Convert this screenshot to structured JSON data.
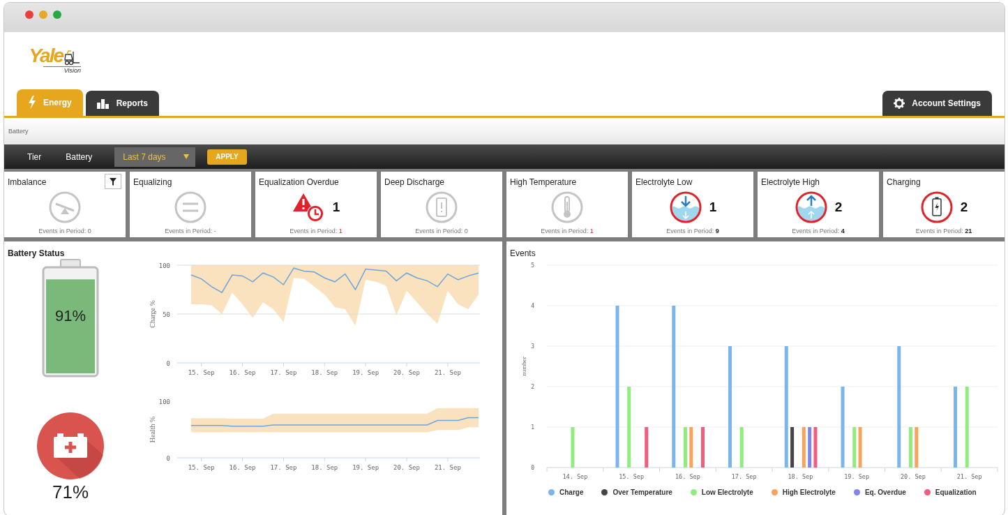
{
  "window": {
    "controls": [
      {
        "color": "#e8403a"
      },
      {
        "color": "#e6a92a"
      },
      {
        "color": "#27a844"
      }
    ]
  },
  "logo": {
    "brand": "Yale",
    "sub": "Vision"
  },
  "tabs": [
    {
      "label": "Energy",
      "kind": "bolt",
      "selected": true
    },
    {
      "label": "Reports",
      "kind": "bars",
      "selected": false
    }
  ],
  "account_button": {
    "label": "Account Settings"
  },
  "breadcrumb": "Battery",
  "filter_bar": {
    "items": [
      "Tier",
      "Battery"
    ],
    "period": {
      "value": "Last 7 days"
    },
    "apply": "APPLY"
  },
  "tiles": [
    {
      "title": "Imbalance",
      "kind": "seesaw",
      "filter_button": true,
      "events_label": "Events in Period:",
      "events_value": "0",
      "alert": false,
      "emphasized": false
    },
    {
      "title": "Equalizing",
      "kind": "equal",
      "filter_button": false,
      "events_label": "Events in Period:",
      "events_value": "-",
      "alert": false,
      "emphasized": false
    },
    {
      "title": "Equalization Overdue",
      "kind": "warning-clock",
      "count": "1",
      "filter_button": false,
      "events_label": "Events in Period:",
      "events_value": "1",
      "alert": true,
      "emphasized": false
    },
    {
      "title": "Deep Discharge",
      "kind": "battery-alert",
      "filter_button": false,
      "events_label": "Events in Period:",
      "events_value": "0",
      "alert": false,
      "emphasized": false
    },
    {
      "title": "High Temperature",
      "kind": "thermometer",
      "filter_button": false,
      "events_label": "Events in Period:",
      "events_value": "1",
      "alert": true,
      "emphasized": false
    },
    {
      "title": "Electrolyte Low",
      "kind": "water-down",
      "count": "1",
      "filter_button": false,
      "events_label": "Events in Period:",
      "events_value": "9",
      "alert": false,
      "emphasized": true
    },
    {
      "title": "Electrolyte High",
      "kind": "water-up",
      "count": "2",
      "filter_button": false,
      "events_label": "Events in Period:",
      "events_value": "4",
      "alert": false,
      "emphasized": true
    },
    {
      "title": "Charging",
      "kind": "battery-bolt",
      "count": "2",
      "filter_button": false,
      "events_label": "Events in Period:",
      "events_value": "21",
      "alert": false,
      "emphasized": true
    }
  ],
  "battery_status": {
    "title": "Battery Status",
    "charge": {
      "reading": "91%"
    },
    "health": {
      "reading": "71%"
    },
    "charge_chart": {
      "chart_data": {
        "type": "line",
        "grid": true,
        "ylabel": "Charge %",
        "ylim": [
          0,
          100
        ],
        "yticks": [
          0,
          50,
          100
        ],
        "categories": [
          null,
          "15. Sep",
          null,
          null,
          null,
          "16. Sep",
          null,
          null,
          null,
          "17. Sep",
          null,
          null,
          null,
          "18. Sep",
          null,
          null,
          null,
          "19. Sep",
          null,
          null,
          null,
          "20. Sep",
          null,
          null,
          null,
          "21. Sep",
          null,
          null,
          null
        ],
        "series": [
          {
            "type": "line",
            "color": "#6ea4dc",
            "values": [
              90,
              86,
              78,
              72,
              90,
              89,
              83,
              92,
              88,
              80,
              97,
              94,
              93,
              87,
              83,
              91,
              75,
              96,
              95,
              94,
              84,
              92,
              87,
              84,
              78,
              91,
              85,
              89,
              92
            ]
          },
          {
            "type": "area",
            "color": "#fbe2bf",
            "values": [
              100,
              100,
              100,
              100,
              100,
              100,
              100,
              100,
              100,
              100,
              100,
              100,
              100,
              100,
              100,
              100,
              100,
              100,
              100,
              100,
              100,
              100,
              100,
              100,
              100,
              100,
              100,
              100,
              100
            ]
          },
          {
            "type": "area",
            "color": "#ffffff",
            "values": [
              60,
              60,
              59,
              50,
              72,
              60,
              46,
              62,
              55,
              42,
              87,
              86,
              78,
              70,
              57,
              55,
              38,
              85,
              83,
              79,
              49,
              74,
              62,
              50,
              40,
              74,
              60,
              55,
              70
            ]
          }
        ]
      }
    },
    "health_chart": {
      "chart_data": {
        "type": "line",
        "ylabel": "Health %",
        "ylim": [
          0,
          100
        ],
        "yticks": [
          0,
          100
        ],
        "categories": [
          null,
          "15. Sep",
          null,
          null,
          null,
          "16. Sep",
          null,
          null,
          null,
          "17. Sep",
          null,
          null,
          null,
          "18. Sep",
          null,
          null,
          null,
          "19. Sep",
          null,
          null,
          null,
          "20. Sep",
          null,
          null,
          null,
          "21. Sep",
          null,
          null,
          null
        ],
        "series": [
          {
            "type": "line",
            "color": "#6ea4dc",
            "values": [
              57,
              57,
              57,
              57,
              56,
              56,
              56,
              56,
              58,
              58,
              58,
              58,
              58,
              58,
              58,
              58,
              58,
              58,
              58,
              58,
              58,
              58,
              58,
              58,
              66,
              66,
              66,
              71,
              71
            ]
          },
          {
            "type": "area",
            "color": "#fbe2bf",
            "values": [
              70,
              70,
              70,
              70,
              69,
              69,
              69,
              69,
              78,
              78,
              78,
              78,
              78,
              78,
              78,
              78,
              78,
              78,
              78,
              78,
              78,
              78,
              78,
              78,
              88,
              88,
              88,
              88,
              88
            ]
          },
          {
            "type": "area",
            "color": "#ffffff",
            "values": [
              45,
              45,
              45,
              45,
              45,
              45,
              45,
              45,
              45,
              45,
              45,
              45,
              45,
              45,
              45,
              45,
              45,
              45,
              45,
              45,
              45,
              45,
              45,
              45,
              49,
              49,
              49,
              54,
              54
            ]
          }
        ]
      }
    }
  },
  "events": {
    "title": "Events",
    "chart_data": {
      "type": "bar",
      "grid": true,
      "ylabel": "number",
      "ylim": [
        0,
        5
      ],
      "yticks": [
        0,
        1,
        2,
        3,
        4,
        5
      ],
      "categories": [
        "14. Sep",
        "15. Sep",
        "16. Sep",
        "17. Sep",
        "18. Sep",
        "19. Sep",
        "20. Sep",
        "21. Sep"
      ],
      "series": [
        {
          "name": "Charge",
          "color": "#7cb5ec",
          "values": [
            0,
            4,
            4,
            3,
            3,
            2,
            3,
            2
          ]
        },
        {
          "name": "Over Temperature",
          "color": "#434348",
          "values": [
            0,
            0,
            0,
            0,
            1,
            0,
            0,
            0
          ]
        },
        {
          "name": "Low Electrolyte",
          "color": "#90ed7d",
          "values": [
            1,
            2,
            1,
            1,
            0,
            1,
            1,
            2
          ]
        },
        {
          "name": "High Electrolyte",
          "color": "#f7a35c",
          "values": [
            0,
            0,
            1,
            0,
            1,
            1,
            1,
            0
          ]
        },
        {
          "name": "Eq. Overdue",
          "color": "#8085e9",
          "values": [
            0,
            0,
            0,
            0,
            1,
            0,
            0,
            0
          ]
        },
        {
          "name": "Equalization",
          "color": "#f15c80",
          "values": [
            0,
            1,
            1,
            0,
            1,
            0,
            0,
            0
          ]
        }
      ]
    }
  }
}
